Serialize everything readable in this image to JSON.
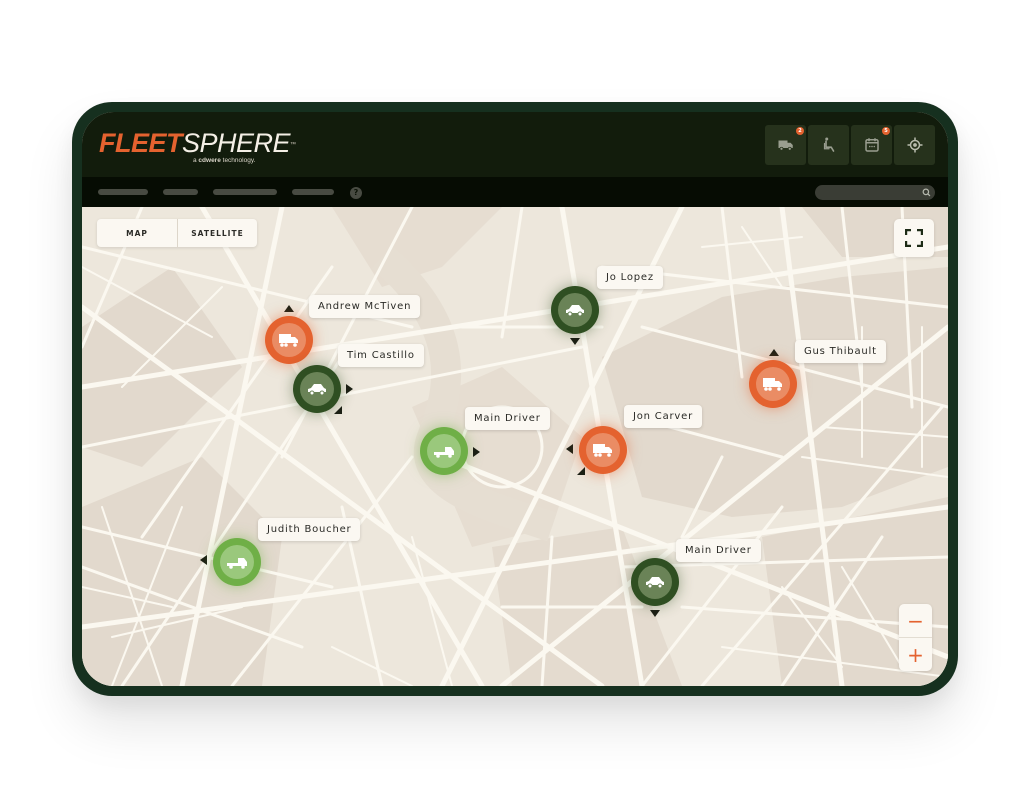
{
  "brand": {
    "name_part1": "FLEET",
    "name_part2": "SPHERE",
    "trademark": "™",
    "tagline_prefix": "a ",
    "tagline_brand": "cdwere",
    "tagline_suffix": " technology."
  },
  "header": {
    "icons": [
      {
        "name": "truck-icon",
        "badge": "2"
      },
      {
        "name": "seat-icon",
        "badge": null
      },
      {
        "name": "calendar-icon",
        "badge": "5"
      },
      {
        "name": "locate-icon",
        "badge": null
      }
    ]
  },
  "navbar": {
    "help_label": "?",
    "search_placeholder": ""
  },
  "map": {
    "toggle": {
      "map_label": "MAP",
      "satellite_label": "SATELLITE",
      "active": "MAP"
    },
    "zoom_out_label": "−",
    "zoom_in_label": "+",
    "colors": {
      "orange": "#e4622f",
      "dark_green": "#2f4f22",
      "light_green": "#6faf47",
      "land": "#ede7dc",
      "road": "#fbf8f0"
    },
    "vehicles": [
      {
        "driver": "Andrew McTiven",
        "vehicle": "box-truck",
        "status": "orange",
        "heading": "up"
      },
      {
        "driver": "Tim Castillo",
        "vehicle": "car",
        "status": "dark-green",
        "heading": "right"
      },
      {
        "driver": "Jo Lopez",
        "vehicle": "car",
        "status": "dark-green",
        "heading": "down"
      },
      {
        "driver": "Main Driver",
        "vehicle": "flatbed-truck",
        "status": "light-green",
        "heading": "right"
      },
      {
        "driver": "Jon Carver",
        "vehicle": "box-truck",
        "status": "orange",
        "heading": "left"
      },
      {
        "driver": "Gus Thibault",
        "vehicle": "box-truck",
        "status": "orange",
        "heading": "up"
      },
      {
        "driver": "Judith Boucher",
        "vehicle": "flatbed-truck",
        "status": "light-green",
        "heading": "left"
      },
      {
        "driver": "Main Driver",
        "vehicle": "car",
        "status": "dark-green",
        "heading": "down"
      }
    ]
  }
}
